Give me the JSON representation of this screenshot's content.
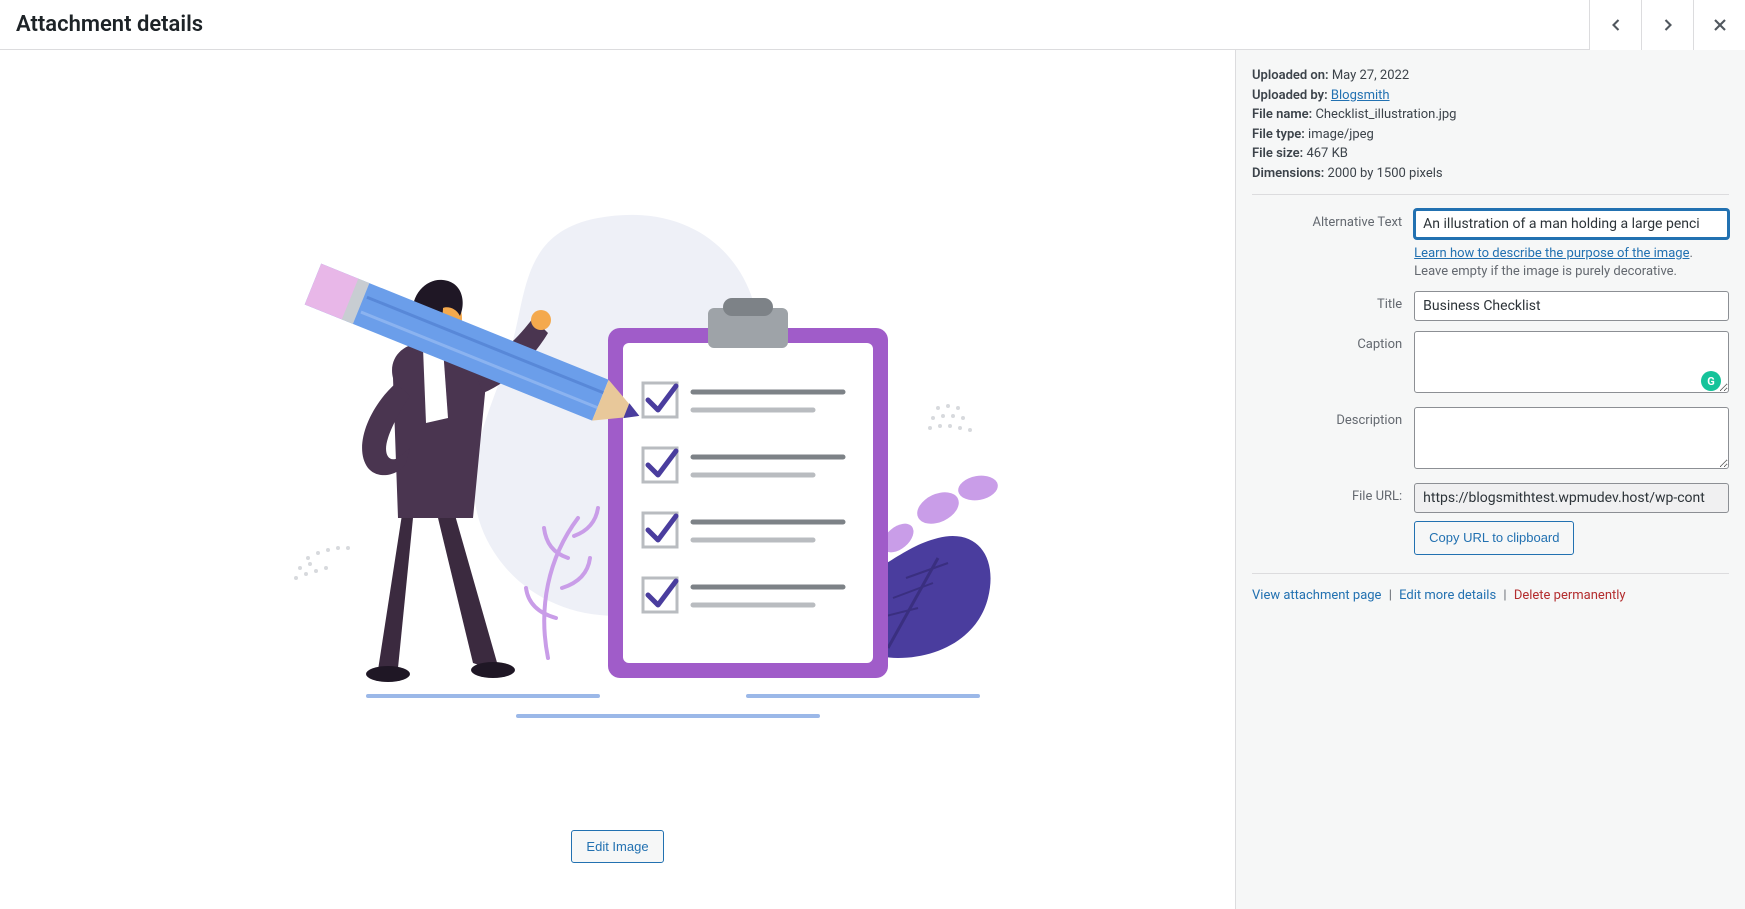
{
  "header": {
    "title": "Attachment details"
  },
  "meta": {
    "uploaded_on_label": "Uploaded on:",
    "uploaded_on": "May 27, 2022",
    "uploaded_by_label": "Uploaded by:",
    "uploaded_by": "Blogsmith",
    "file_name_label": "File name:",
    "file_name": "Checklist_illustration.jpg",
    "file_type_label": "File type:",
    "file_type": "image/jpeg",
    "file_size_label": "File size:",
    "file_size": "467 KB",
    "dimensions_label": "Dimensions:",
    "dimensions": "2000 by 1500 pixels"
  },
  "fields": {
    "alt_label": "Alternative Text",
    "alt_value": "An illustration of a man holding a large penci",
    "alt_help_link": "Learn how to describe the purpose of the image",
    "alt_help_tail": ". Leave empty if the image is purely decorative.",
    "title_label": "Title",
    "title_value": "Business Checklist",
    "caption_label": "Caption",
    "caption_value": "",
    "description_label": "Description",
    "description_value": "",
    "file_url_label": "File URL:",
    "file_url_value": "https://blogsmithtest.wpmudev.host/wp-cont",
    "copy_btn": "Copy URL to clipboard"
  },
  "buttons": {
    "edit_image": "Edit Image"
  },
  "actions": {
    "view": "View attachment page",
    "edit": "Edit more details",
    "delete": "Delete permanently"
  }
}
